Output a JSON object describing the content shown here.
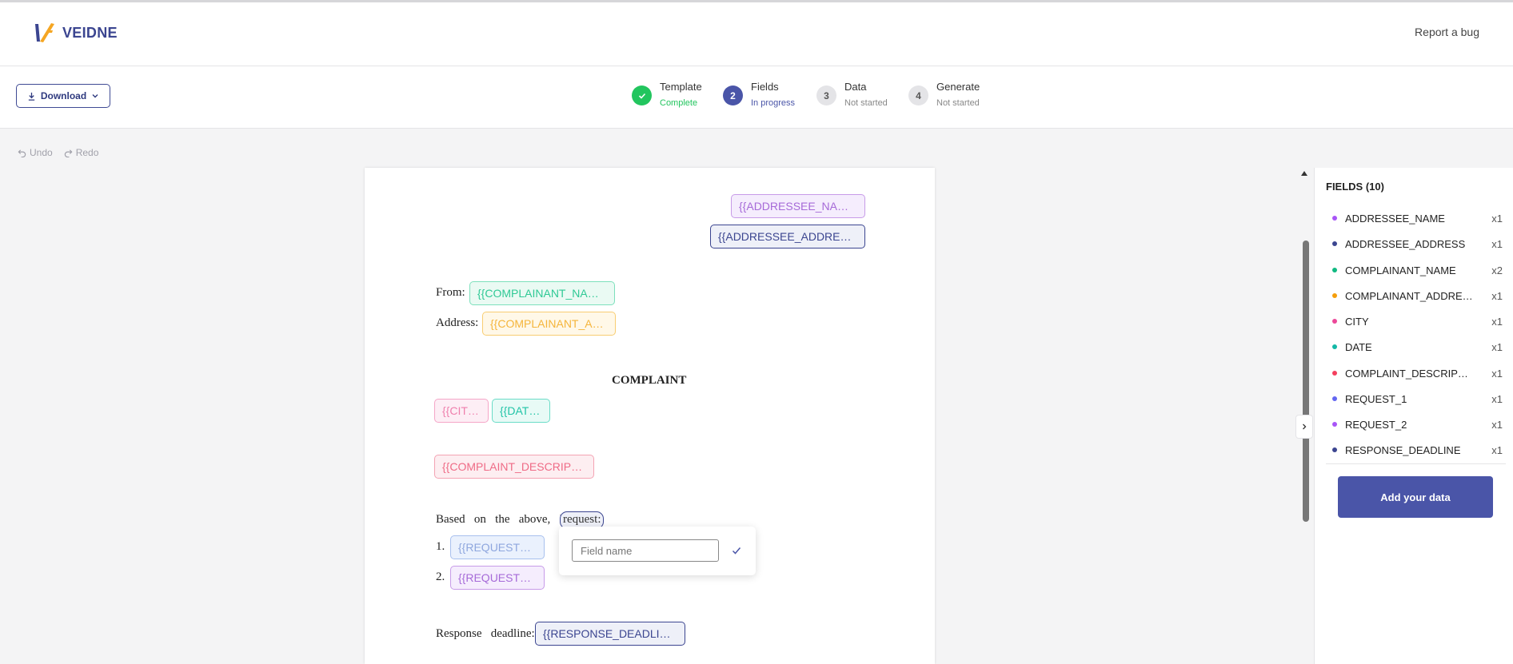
{
  "app": {
    "logo_text": "VEIDNE",
    "report_bug": "Report a bug"
  },
  "toolbar": {
    "download_label": "Download",
    "undo_label": "Undo",
    "redo_label": "Redo"
  },
  "steps": [
    {
      "number": "1",
      "title": "Template",
      "status": "Complete"
    },
    {
      "number": "2",
      "title": "Fields",
      "status": "In progress"
    },
    {
      "number": "3",
      "title": "Data",
      "status": "Not started"
    },
    {
      "number": "4",
      "title": "Generate",
      "status": "Not started"
    }
  ],
  "document": {
    "addressee_name": "{{ADDRESSEE_NAME}}",
    "addressee_address": "{{ADDRESSEE_ADDRESS}}",
    "from_label": "From:",
    "complainant_name": "{{COMPLAINANT_NAME}}",
    "address_label": "Address:",
    "complainant_address": "{{COMPLAINANT_ADDRESS}}",
    "heading": "COMPLAINT",
    "city": "{{CITY}}",
    "date": "{{DATE}}",
    "complaint_description": "{{COMPLAINT_DESCRIPTION}}",
    "request_intro": "Based   on   the   above,   I",
    "request_word": "request:",
    "item1": "1.",
    "request_1": "{{REQUEST_1}}",
    "item2": "2.",
    "request_2": "{{REQUEST_2}}",
    "deadline_label": "Response   deadline:",
    "response_deadline": "{{RESPONSE_DEADLINE}}"
  },
  "popup": {
    "placeholder": "Field name",
    "value": ""
  },
  "fields_panel": {
    "title": "FIELDS (10)",
    "items": [
      {
        "name": "ADDRESSEE_NAME",
        "count": "x1",
        "color": "#a855f7"
      },
      {
        "name": "ADDRESSEE_ADDRESS",
        "count": "x1",
        "color": "#3b4590"
      },
      {
        "name": "COMPLAINANT_NAME",
        "count": "x2",
        "color": "#10b981"
      },
      {
        "name": "COMPLAINANT_ADDRESS",
        "count": "x1",
        "color": "#f59e0b"
      },
      {
        "name": "CITY",
        "count": "x1",
        "color": "#ec4899"
      },
      {
        "name": "DATE",
        "count": "x1",
        "color": "#14b8a6"
      },
      {
        "name": "COMPLAINT_DESCRIPTION",
        "count": "x1",
        "color": "#f43f5e"
      },
      {
        "name": "REQUEST_1",
        "count": "x1",
        "color": "#6366f1"
      },
      {
        "name": "REQUEST_2",
        "count": "x1",
        "color": "#a855f7"
      },
      {
        "name": "RESPONSE_DEADLINE",
        "count": "x1",
        "color": "#3b4590"
      }
    ],
    "add_data_label": "Add your data"
  },
  "colors": {
    "brand": "#4a55a8",
    "complete": "#22c55e"
  }
}
